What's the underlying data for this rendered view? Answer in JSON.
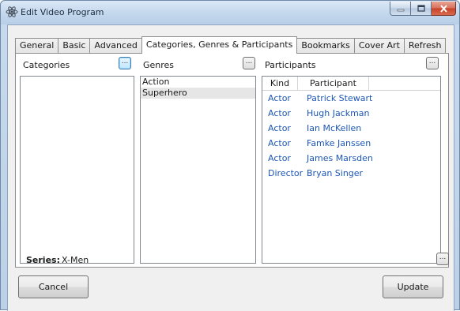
{
  "window": {
    "title": "Edit Video Program",
    "icon": "atom-icon"
  },
  "tabs": [
    {
      "label": "General"
    },
    {
      "label": "Basic"
    },
    {
      "label": "Advanced"
    },
    {
      "label": "Categories, Genres & Participants",
      "active": true
    },
    {
      "label": "Bookmarks"
    },
    {
      "label": "Cover Art"
    },
    {
      "label": "Refresh"
    }
  ],
  "categories": {
    "label": "Categories",
    "edit_button": "...",
    "items": []
  },
  "genres": {
    "label": "Genres",
    "edit_button": "...",
    "items": [
      "Action",
      "Superhero"
    ],
    "selected": "Superhero"
  },
  "participants": {
    "label": "Participants",
    "edit_button": "...",
    "columns": [
      "Kind",
      "Participant"
    ],
    "rows": [
      {
        "kind": "Actor",
        "participant": "Patrick Stewart"
      },
      {
        "kind": "Actor",
        "participant": "Hugh Jackman"
      },
      {
        "kind": "Actor",
        "participant": "Ian McKellen"
      },
      {
        "kind": "Actor",
        "participant": "Famke Janssen"
      },
      {
        "kind": "Actor",
        "participant": "James Marsden"
      },
      {
        "kind": "Director",
        "participant": "Bryan Singer"
      }
    ]
  },
  "series": {
    "label": "Series:",
    "value": "X-Men",
    "edit_button": "..."
  },
  "buttons": {
    "cancel": "Cancel",
    "update": "Update"
  },
  "colors": {
    "participant_text": "#1c56b6",
    "selection": "#e6e6e6",
    "close_button": "#c7412a"
  }
}
